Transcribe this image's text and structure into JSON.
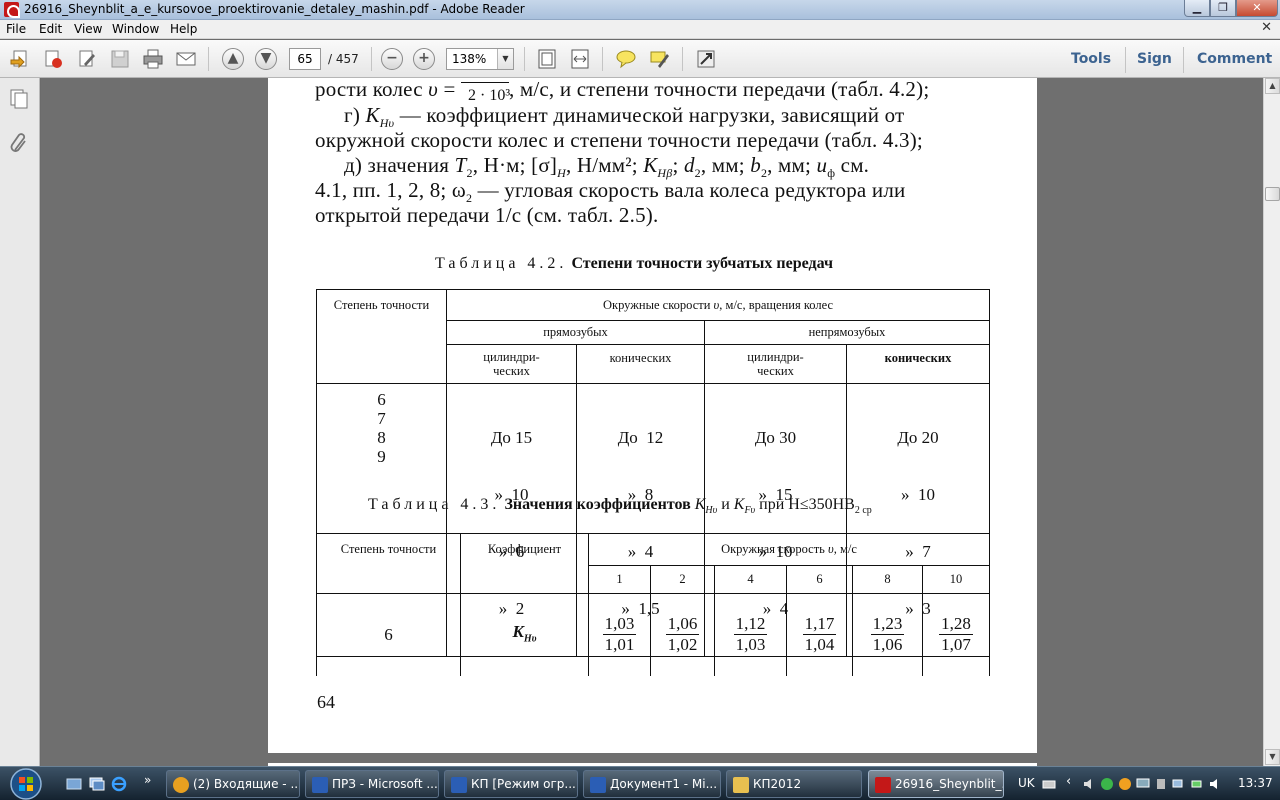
{
  "window": {
    "title": "26916_Sheynblit_a_e_kursovoe_proektirovanie_detaley_mashin.pdf - Adobe Reader"
  },
  "menu": [
    "File",
    "Edit",
    "View",
    "Window",
    "Help"
  ],
  "toolbar": {
    "page_current": "65",
    "page_total": "/ 457",
    "zoom": "138%",
    "links": [
      "Tools",
      "Sign",
      "Comment"
    ]
  },
  "doc": {
    "text_lines": [
      "рости колес υ = ────, м/с, и степени точности передачи (табл. 4.2);",
      "г) K_Hυ — коэффициент динамической нагрузки, зависящий от",
      "окружной скорости колес и степени точности передачи (табл. 4.3);",
      "д) значения T₂, Н·м; [σ]_H, Н/мм²; K_Hβ; d₂, мм; b₂, мм; u_ф см.",
      "4.1, пп. 1, 2, 8; ω₂ — угловая скорость вала колеса редуктора или",
      "открытой передачи 1/с (см. табл. 2.5)."
    ],
    "top_fraction_den": "2 · 10³",
    "table42": {
      "caption_prefix": "Таблица 4.2.",
      "caption_title": "Степени точности зубчатых передач",
      "h_degree": "Степень точности",
      "h_speed": "Окружные скорости υ, м/с, вращения колес",
      "h_straight": "прямозубых",
      "h_nonstraight": "непрямозубых",
      "h_cyl": "цилиндри-\nческих",
      "h_con": "конических",
      "degrees": [
        "6",
        "7",
        "8",
        "9"
      ],
      "c1": [
        "До 15",
        "»  10",
        "»  6",
        "»  2"
      ],
      "c2": [
        "До  12",
        "»  8",
        "»  4",
        "»  1,5"
      ],
      "c3": [
        "До 30",
        "»  15",
        "»  10",
        "»  4"
      ],
      "c4": [
        "До 20",
        "»  10",
        "»  7",
        "»  3"
      ]
    },
    "table43": {
      "caption_prefix": "Таблица 4.3.",
      "caption_title": "Значения коэффициентов",
      "caption_rest": "при H≤350HB",
      "caption_k1": "K",
      "caption_k1_sub": "Hυ",
      "caption_and": "и",
      "caption_k2": "K",
      "caption_k2_sub": "Fυ",
      "caption_hb_sub": "2 ср",
      "h_degree": "Степень точности",
      "h_coef": "Коэффициент",
      "h_speed": "Окружная скорость υ, м/с",
      "speeds": [
        "1",
        "2",
        "4",
        "6",
        "8",
        "10"
      ],
      "row_degree": "6",
      "row_coef": "K",
      "row_coef_sub": "Hυ",
      "nums": [
        "1,03",
        "1,06",
        "1,12",
        "1,17",
        "1,23",
        "1,28"
      ],
      "dens": [
        "1,01",
        "1,02",
        "1,03",
        "1,04",
        "1,06",
        "1,07"
      ]
    },
    "page_number": "64"
  },
  "taskbar": {
    "items": [
      {
        "label": "(2) Входящие - ...",
        "color": "#e8a020"
      },
      {
        "label": "ПРЗ - Microsoft ...",
        "color": "#2b5eb5"
      },
      {
        "label": "КП [Режим огр...",
        "color": "#2b5eb5"
      },
      {
        "label": "Документ1 - Mi...",
        "color": "#2b5eb5"
      },
      {
        "label": "КП2012",
        "color": "#e8c050"
      },
      {
        "label": "26916_Sheynblit_...",
        "color": "#c41818"
      }
    ],
    "lang": "UK",
    "clock": "13:37"
  }
}
